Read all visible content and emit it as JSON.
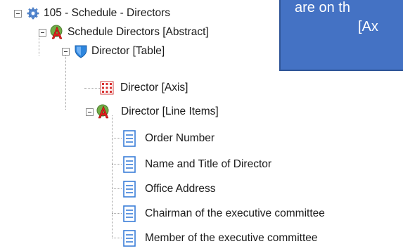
{
  "tree": {
    "root": {
      "label": "105 - Schedule - Directors",
      "icon": "gear-icon"
    },
    "abstract": {
      "label": "Schedule Directors [Abstract]",
      "icon": "abstract-icon"
    },
    "table": {
      "label": "Director [Table]",
      "icon": "table-icon"
    },
    "axis": {
      "label": "Director [Axis]",
      "icon": "axis-icon"
    },
    "line_items": {
      "label": "Director [Line Items]",
      "icon": "line-items-icon"
    },
    "elements": [
      {
        "label": "Order Number",
        "icon": "element-icon"
      },
      {
        "label": "Name and Title of Director",
        "icon": "element-icon"
      },
      {
        "label": "Office Address",
        "icon": "element-icon"
      },
      {
        "label": "Chairman of the executive committee",
        "icon": "element-icon"
      },
      {
        "label": "Member of the executive committee",
        "icon": "element-icon"
      }
    ]
  },
  "callout": {
    "line1": "are on th",
    "line2": "[Ax"
  }
}
